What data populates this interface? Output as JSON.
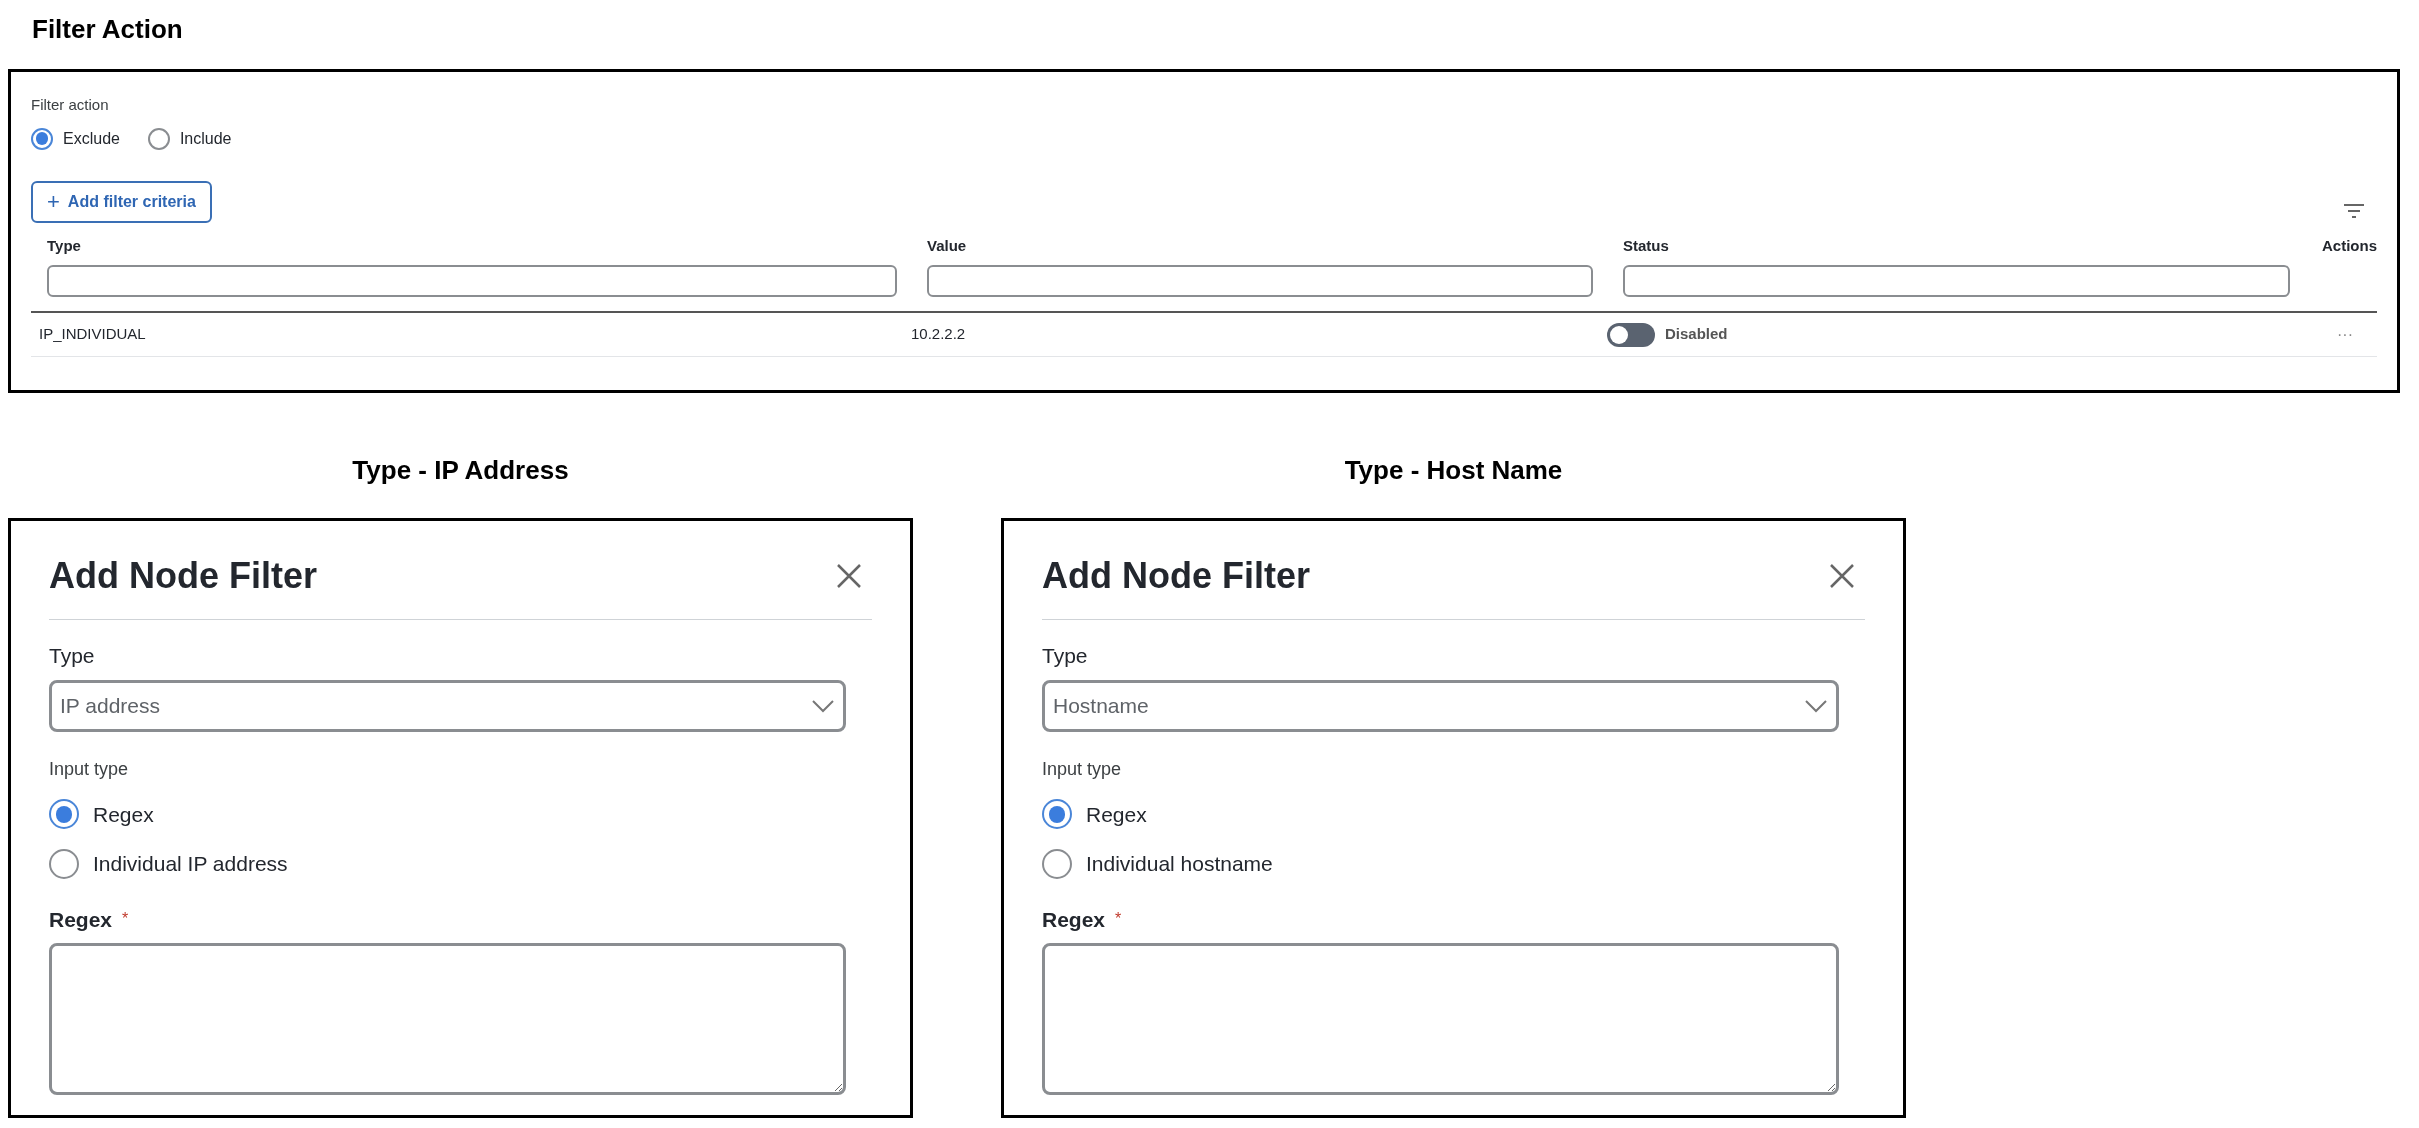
{
  "header": {
    "title": "Filter Action"
  },
  "filter_panel": {
    "label": "Filter action",
    "options": [
      {
        "label": "Exclude",
        "selected": true
      },
      {
        "label": "Include",
        "selected": false
      }
    ],
    "add_button": {
      "icon": "+",
      "label": "Add filter criteria"
    },
    "table": {
      "columns": [
        {
          "label": "Type",
          "filter": true
        },
        {
          "label": "Value",
          "filter": true
        },
        {
          "label": "Status",
          "filter": true
        },
        {
          "label": "Actions",
          "filter": false
        }
      ],
      "rows": [
        {
          "type": "IP_INDIVIDUAL",
          "value": "10.2.2.2",
          "status": {
            "on": false,
            "label": "Disabled"
          },
          "actions": "···"
        }
      ]
    }
  },
  "dialogs": [
    {
      "caption": "Type - IP Address",
      "title": "Add Node Filter",
      "type_label": "Type",
      "type_value": "IP address",
      "input_type_label": "Input type",
      "options": [
        {
          "label": "Regex",
          "selected": true
        },
        {
          "label": "Individual IP address",
          "selected": false
        }
      ],
      "field_label": "Regex",
      "required_mark": "*"
    },
    {
      "caption": "Type - Host Name",
      "title": "Add Node Filter",
      "type_label": "Type",
      "type_value": "Hostname",
      "input_type_label": "Input type",
      "options": [
        {
          "label": "Regex",
          "selected": true
        },
        {
          "label": "Individual hostname",
          "selected": false
        }
      ],
      "field_label": "Regex",
      "required_mark": "*"
    }
  ]
}
